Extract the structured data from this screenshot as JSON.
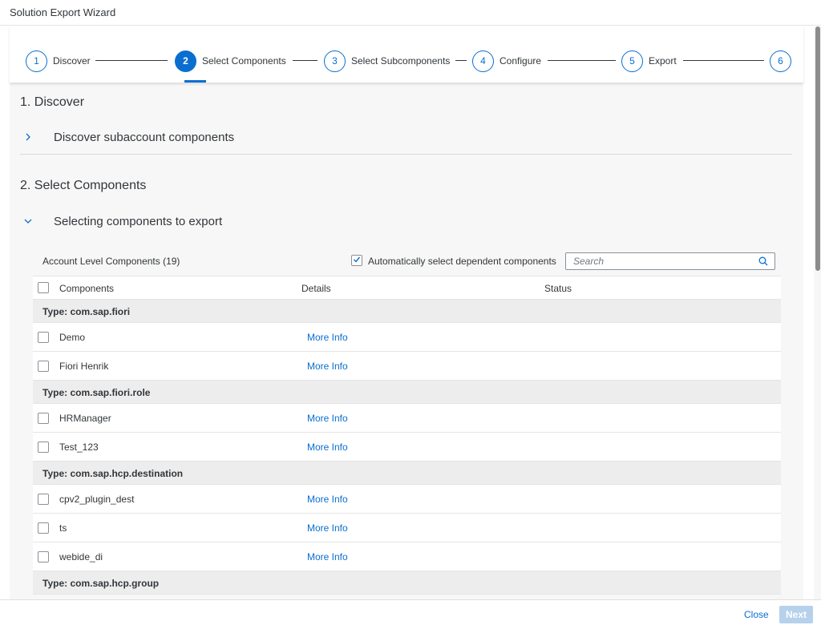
{
  "window": {
    "title": "Solution Export Wizard"
  },
  "steps": [
    {
      "number": "1",
      "label": "Discover"
    },
    {
      "number": "2",
      "label": "Select Components"
    },
    {
      "number": "3",
      "label": "Select Subcomponents"
    },
    {
      "number": "4",
      "label": "Configure"
    },
    {
      "number": "5",
      "label": "Export"
    },
    {
      "number": "6",
      "label": ""
    }
  ],
  "active_step": 2,
  "section1": {
    "title": "1. Discover",
    "panel": {
      "label": "Discover subaccount components",
      "expanded": false,
      "icon": "chevron-right-icon"
    }
  },
  "section2": {
    "title": "2. Select Components",
    "panel": {
      "label": "Selecting components to export",
      "expanded": true,
      "icon": "chevron-down-icon"
    }
  },
  "table": {
    "title": "Account Level Components (19)",
    "auto_select": {
      "label": "Automatically select dependent components",
      "checked": true
    },
    "search": {
      "placeholder": "Search",
      "value": ""
    },
    "columns": [
      "Components",
      "Details",
      "Status"
    ],
    "groups": [
      {
        "type": "Type: com.sap.fiori",
        "items": [
          {
            "name": "Demo",
            "details": "More Info",
            "status": ""
          },
          {
            "name": "Fiori Henrik",
            "details": "More Info",
            "status": ""
          }
        ]
      },
      {
        "type": "Type: com.sap.fiori.role",
        "items": [
          {
            "name": "HRManager",
            "details": "More Info",
            "status": ""
          },
          {
            "name": "Test_123",
            "details": "More Info",
            "status": ""
          }
        ]
      },
      {
        "type": "Type: com.sap.hcp.destination",
        "items": [
          {
            "name": "cpv2_plugin_dest",
            "details": "More Info",
            "status": ""
          },
          {
            "name": "ts",
            "details": "More Info",
            "status": ""
          },
          {
            "name": "webide_di",
            "details": "More Info",
            "status": ""
          }
        ]
      },
      {
        "type": "Type: com.sap.hcp.group",
        "items": []
      }
    ]
  },
  "footer": {
    "close_label": "Close",
    "next_label": "Next"
  },
  "colors": {
    "accent": "#0a6ed1",
    "group_bg": "#ededed",
    "content_bg": "#f7f7f7",
    "next_disabled": "#b6d1ec"
  }
}
